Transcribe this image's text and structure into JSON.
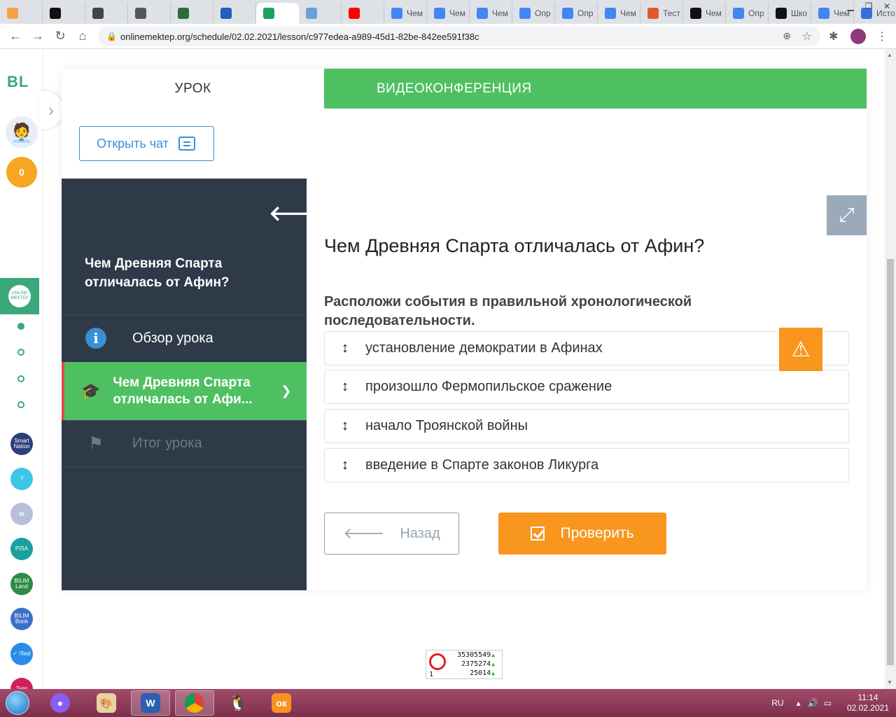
{
  "browser": {
    "tabs": [
      {
        "label": "",
        "icon": "bookmark-icon",
        "color": "#f4a24a"
      },
      {
        "label": "",
        "icon": "znanija-icon",
        "color": "#111111"
      },
      {
        "label": "",
        "icon": "face-icon",
        "color": "#444444"
      },
      {
        "label": "",
        "icon": "clock-icon",
        "color": "#555555"
      },
      {
        "label": "",
        "icon": "chess-icon",
        "color": "#2f6b3a"
      },
      {
        "label": "",
        "icon": "mail-icon",
        "color": "#1f5fbf"
      },
      {
        "label": "",
        "icon": "sheets-icon",
        "color": "#1aa260"
      },
      {
        "label": "",
        "icon": "puzzle-icon",
        "color": "#6aa0d8"
      },
      {
        "label": "",
        "icon": "youtube-icon",
        "color": "#ff0000"
      },
      {
        "label": "Чем",
        "icon": "google-icon",
        "color": "#4285f4"
      },
      {
        "label": "Чем",
        "icon": "google-icon",
        "color": "#4285f4"
      },
      {
        "label": "Чем",
        "icon": "google-icon",
        "color": "#4285f4"
      },
      {
        "label": "Опр",
        "icon": "google-icon",
        "color": "#4285f4"
      },
      {
        "label": "Опр",
        "icon": "google-icon",
        "color": "#4285f4"
      },
      {
        "label": "Чем",
        "icon": "google-icon",
        "color": "#4285f4"
      },
      {
        "label": "Тест",
        "icon": "check-icon",
        "color": "#e05a2a"
      },
      {
        "label": "Чем",
        "icon": "znanija-icon",
        "color": "#111111"
      },
      {
        "label": "Опр",
        "icon": "google-icon",
        "color": "#4285f4"
      },
      {
        "label": "Шко",
        "icon": "znanija-icon",
        "color": "#111111"
      },
      {
        "label": "Чем",
        "icon": "google-icon",
        "color": "#4285f4"
      },
      {
        "label": "Исто",
        "icon": "history-icon",
        "color": "#3a6fd6"
      }
    ],
    "url": "onlinemektep.org/schedule/02.02.2021/lesson/c977edea-a989-45d1-82be-842ee591f38c"
  },
  "rail": {
    "logo": "BL",
    "coins": "0",
    "om_logo": "ONLINE MEKTEP",
    "apps": [
      {
        "label": "Smart Nation",
        "color": "#2b3f7a"
      },
      {
        "label": "?",
        "color": "#3ec6e8"
      },
      {
        "label": "▤",
        "color": "#b8bfd8"
      },
      {
        "label": "PISA",
        "color": "#1aa0a0"
      },
      {
        "label": "BILIM Land",
        "color": "#2e8a48"
      },
      {
        "label": "BILIM Book",
        "color": "#3a70c8"
      },
      {
        "label": "✓ iTest",
        "color": "#2a8ce8"
      },
      {
        "label": "Twig",
        "color": "#d0205a"
      }
    ]
  },
  "tabs": {
    "lesson": "УРОК",
    "video": "ВИДЕОКОНФЕРЕНЦИЯ"
  },
  "chat": {
    "label": "Открыть чат"
  },
  "sidebar": {
    "title": "Чем Древняя Спарта отличалась от Афин?",
    "items": [
      {
        "label": "Обзор урока"
      },
      {
        "label": "Чем Древняя Спарта отличалась от Афи..."
      },
      {
        "label": "Итог урока"
      }
    ]
  },
  "question": {
    "title": "Чем Древняя Спарта отличалась от Афин?",
    "instruction": "Расположи события в правильной хронологической последовательности.",
    "options": [
      "установление демократии в Афинах",
      "произошло Фермопильское сражение",
      "начало Троянской войны",
      "введение в Спарте законов Ликурга"
    ]
  },
  "buttons": {
    "back": "Назад",
    "check": "Проверить"
  },
  "counter": {
    "line1": "35305549",
    "line2": "2375274",
    "line3": "25014",
    "left": "1"
  },
  "taskbar": {
    "lang": "RU",
    "time": "11:14",
    "date": "02.02.2021"
  }
}
